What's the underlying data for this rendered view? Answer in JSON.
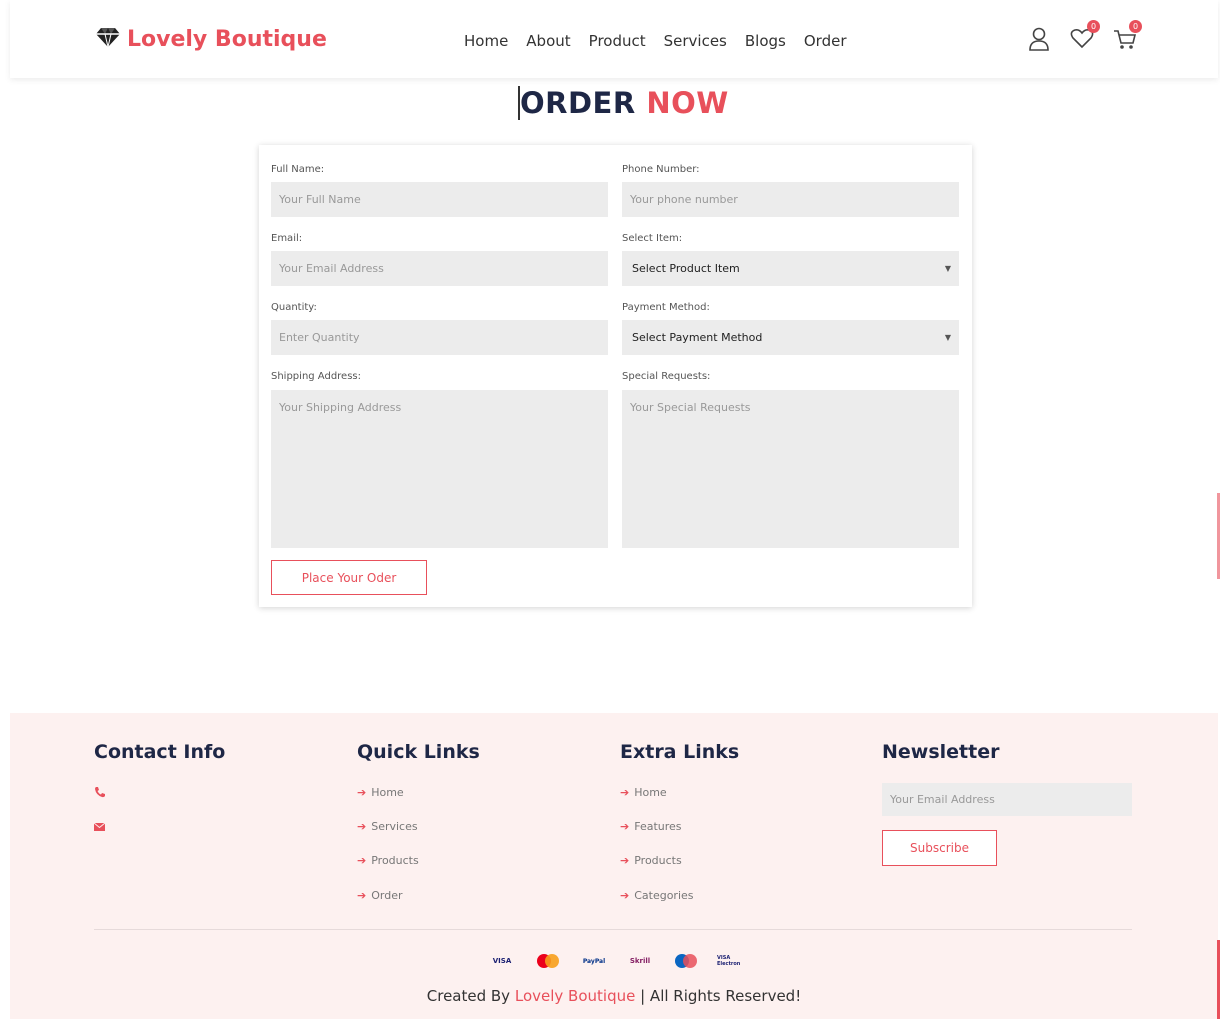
{
  "brand": {
    "name": "Lovely Boutique",
    "color": "#e8505b",
    "icon": "diamond-icon"
  },
  "nav": [
    "Home",
    "About",
    "Product",
    "Services",
    "Blogs",
    "Order"
  ],
  "header_icons": [
    {
      "name": "user-icon"
    },
    {
      "name": "heart-icon",
      "badge": "0"
    },
    {
      "name": "cart-icon",
      "badge": "0"
    }
  ],
  "title": {
    "main": "ORDER",
    "accent": "NOW"
  },
  "form": {
    "full_name": {
      "label": "Full Name:",
      "placeholder": "Your Full Name"
    },
    "phone": {
      "label": "Phone Number:",
      "placeholder": "Your phone number"
    },
    "email": {
      "label": "Email:",
      "placeholder": "Your Email Address"
    },
    "item": {
      "label": "Select Item:",
      "value": "Select Product Item"
    },
    "quantity": {
      "label": "Quantity:",
      "placeholder": "Enter Quantity"
    },
    "payment": {
      "label": "Payment Method:",
      "value": "Select Payment Method"
    },
    "shipping": {
      "label": "Shipping Address:",
      "placeholder": "Your Shipping Address"
    },
    "requests": {
      "label": "Special Requests:",
      "placeholder": "Your Special Requests"
    },
    "submit": "Place Your Oder"
  },
  "footer": {
    "contact_title": "Contact Info",
    "contact_icons": [
      "phone-icon",
      "envelope-icon"
    ],
    "quick_title": "Quick Links",
    "quick_links": [
      "Home",
      "Services",
      "Products",
      "Order"
    ],
    "extra_title": "Extra Links",
    "extra_links": [
      "Home",
      "Features",
      "Products",
      "Categories"
    ],
    "newsletter_title": "Newsletter",
    "newsletter_placeholder": "Your Email Address",
    "subscribe": "Subscribe",
    "payments": [
      "VISA",
      "mastercard",
      "PayPal",
      "Skrill",
      "mastercard",
      "VISA Electron"
    ],
    "credit_prefix": "Created By",
    "credit_brand": "Lovely Boutique",
    "credit_suffix": "| All Rights Reserved!"
  }
}
